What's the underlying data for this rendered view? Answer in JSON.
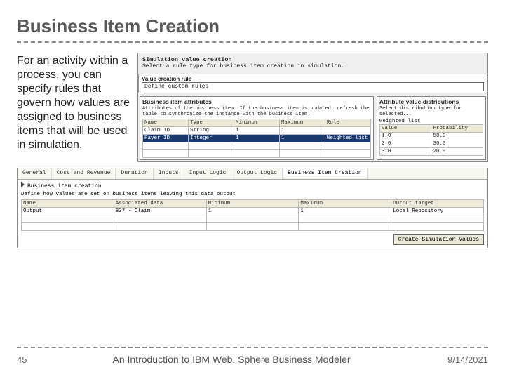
{
  "slide": {
    "title": "Business Item Creation",
    "body": "For an activity within a process, you can specify rules that govern how values are assigned to business items that will be used in simulation."
  },
  "dialog": {
    "title": "Simulation value creation",
    "subtitle": "Select a rule type for business item creation in simulation.",
    "rule_label": "Value creation rule",
    "rule_value": "Define custom rules",
    "attr_panel": {
      "title": "Business item attributes",
      "desc": "Attributes of the business item. If the business item is updated, refresh the table to synchronize the instance with the business item.",
      "cols": [
        "Name",
        "Type",
        "Minimum",
        "Maximum",
        "Rule"
      ],
      "rows": [
        {
          "name": "Claim ID",
          "type": "String",
          "min": "1",
          "max": "1",
          "rule": ""
        },
        {
          "name": "Payer ID",
          "type": "Integer",
          "min": "1",
          "max": "1",
          "rule": "Weighted list"
        }
      ]
    },
    "dist_panel": {
      "title": "Attribute value distributions",
      "desc": "Select distribution type for selected...",
      "list_label": "Weighted list",
      "cols": [
        "Value",
        "Probability"
      ],
      "rows": [
        {
          "v": "1.0",
          "p": "50.0"
        },
        {
          "v": "2.0",
          "p": "30.0"
        },
        {
          "v": "3.0",
          "p": "20.0"
        }
      ]
    }
  },
  "wide": {
    "tabs": [
      "General",
      "Cost and Revenue",
      "Duration",
      "Inputs",
      "Input Logic",
      "Output Logic",
      "Business Item Creation"
    ],
    "active": 6,
    "subtitle": "Business item creation",
    "desc": "Define how values are set on business items leaving this data output",
    "cols": [
      "Name",
      "Associated data",
      "Minimum",
      "Maximum",
      "Output target"
    ],
    "rows": [
      {
        "name": "Output",
        "data": "837 - Claim",
        "min": "1",
        "max": "1",
        "tgt": "Local Repository"
      }
    ],
    "button": "Create Simulation Values"
  },
  "footer": {
    "page": "45",
    "mid": "An Introduction to IBM Web. Sphere Business Modeler",
    "date": "9/14/2021"
  }
}
